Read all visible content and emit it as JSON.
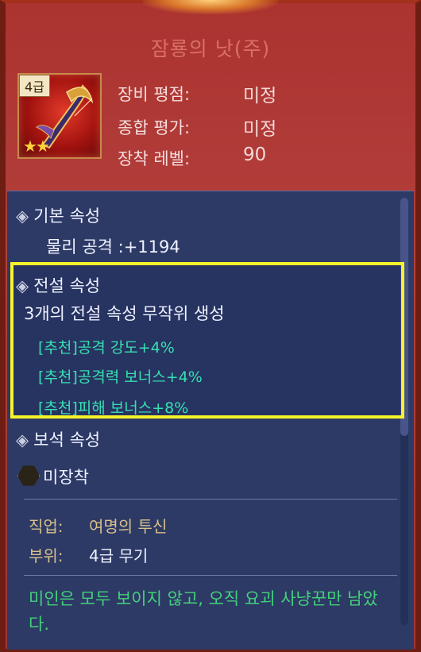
{
  "item": {
    "name": "잠룡의 낫(주)",
    "grade_badge": "4급",
    "stars": "★★",
    "icon": "dragon-scythe-icon"
  },
  "stats": [
    {
      "label": "장비 평점:",
      "value": "미정"
    },
    {
      "label": "종합 평가:",
      "value": "미정"
    },
    {
      "label": "장착 레벨:",
      "value": "90"
    }
  ],
  "basic": {
    "header": "기본 속성",
    "line": "물리 공격 :+1194"
  },
  "legend": {
    "header": "전설 속성",
    "desc": "3개의 전설 속성 무작위 생성",
    "items": [
      "[추천]공격 강도+4%",
      "[추천]공격력 보너스+4%",
      "[추천]피해 보너스+8%"
    ]
  },
  "gem": {
    "header": "보석 속성",
    "status": "미장착"
  },
  "info": {
    "job_label": "직업:",
    "job_value": "여명의 투신",
    "slot_label": "부위:",
    "slot_value": "4급 무기"
  },
  "flavor": "미인은 모두 보이지 않고, 오직 요괴 사냥꾼만 남았다.",
  "colors": {
    "accent_green": "#37e0b0",
    "quote_green": "#43d17a",
    "highlight": "#f7f52a",
    "title_red": "#d97066",
    "tan": "#d8c08a"
  }
}
